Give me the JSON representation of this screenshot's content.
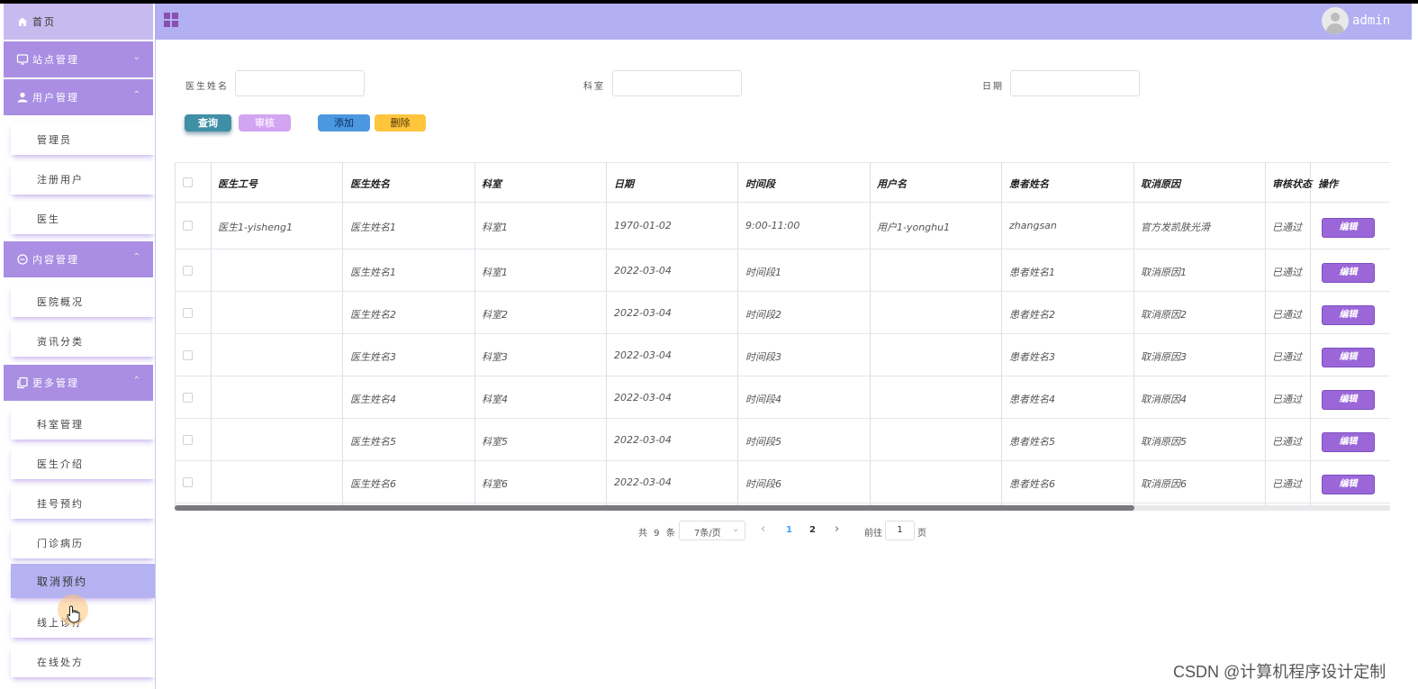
{
  "header": {
    "user": "admin"
  },
  "sidebar": {
    "home": "首页",
    "groups": [
      {
        "label": "站点管理",
        "icon": "monitor-icon",
        "chevron": "⌄"
      },
      {
        "label": "用户管理",
        "icon": "user-icon",
        "chevron": "⌃"
      },
      {
        "label": "内容管理",
        "icon": "chat-icon",
        "chevron": "⌃"
      },
      {
        "label": "更多管理",
        "icon": "copy-icon",
        "chevron": "⌃"
      }
    ],
    "items": [
      "管理员",
      "注册用户",
      "医生",
      "医院概况",
      "资讯分类",
      "科室管理",
      "医生介绍",
      "挂号预约",
      "门诊病历",
      "取消预约",
      "线上诊疗",
      "在线处方"
    ]
  },
  "search": {
    "doctor_name_label": "医生姓名",
    "dept_label": "科室",
    "date_label": "日期",
    "query_btn": "查询",
    "review_btn": "审核",
    "add_btn": "添加",
    "delete_btn": "删除"
  },
  "table": {
    "headers": [
      "医生工号",
      "医生姓名",
      "科室",
      "日期",
      "时间段",
      "用户名",
      "患者姓名",
      "取消原因",
      "审核状态",
      "操作"
    ],
    "edit_label": "编辑",
    "rows": [
      [
        "医生1-yisheng1",
        "医生姓名1",
        "科室1",
        "1970-01-02",
        "9:00-11:00",
        "用户1-yonghu1",
        "zhangsan",
        "官方发凯肤光滑",
        "已通过"
      ],
      [
        "",
        "医生姓名1",
        "科室1",
        "2022-03-04",
        "时间段1",
        "",
        "患者姓名1",
        "取消原因1",
        "已通过"
      ],
      [
        "",
        "医生姓名2",
        "科室2",
        "2022-03-04",
        "时间段2",
        "",
        "患者姓名2",
        "取消原因2",
        "已通过"
      ],
      [
        "",
        "医生姓名3",
        "科室3",
        "2022-03-04",
        "时间段3",
        "",
        "患者姓名3",
        "取消原因3",
        "已通过"
      ],
      [
        "",
        "医生姓名4",
        "科室4",
        "2022-03-04",
        "时间段4",
        "",
        "患者姓名4",
        "取消原因4",
        "已通过"
      ],
      [
        "",
        "医生姓名5",
        "科室5",
        "2022-03-04",
        "时间段5",
        "",
        "患者姓名5",
        "取消原因5",
        "已通过"
      ],
      [
        "",
        "医生姓名6",
        "科室6",
        "2022-03-04",
        "时间段6",
        "",
        "患者姓名6",
        "取消原因6",
        "已通过"
      ]
    ]
  },
  "pagination": {
    "total": "共 9 条",
    "page_size": "7条/页",
    "prev": "‹",
    "pages": [
      "1",
      "2"
    ],
    "next": "›",
    "goto_label": "前往",
    "goto_value": "1",
    "goto_suffix": "页"
  },
  "watermark": "CSDN @计算机程序设计定制",
  "colors": {
    "header_bg": "#b2b0f2",
    "sidebar_group_bg": "#a98ee3",
    "edit_btn": "#9b67d8",
    "query_btn": "#3f8fa6",
    "review_btn": "#d3a4f2",
    "add_btn": "#4c98e0",
    "delete_btn": "#ffc53d"
  }
}
